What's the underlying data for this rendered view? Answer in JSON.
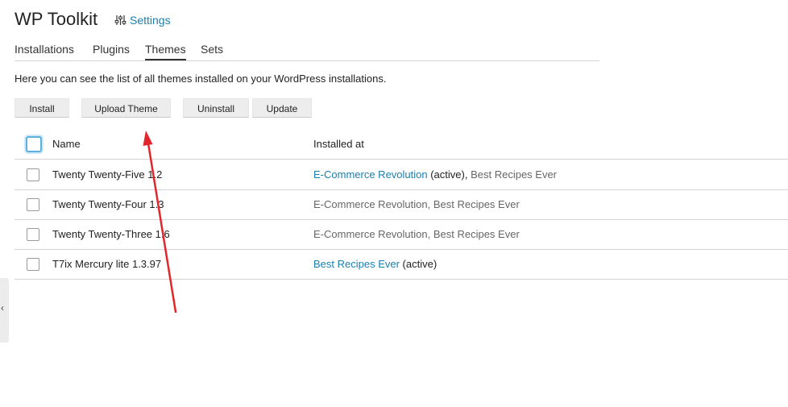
{
  "header": {
    "title": "WP Toolkit",
    "settings_label": "Settings"
  },
  "tabs": [
    {
      "label": "Installations"
    },
    {
      "label": "Plugins"
    },
    {
      "label": "Themes",
      "active": true
    },
    {
      "label": "Sets"
    }
  ],
  "intro": "Here you can see the list of all themes installed on your WordPress installations.",
  "toolbar": {
    "install": "Install",
    "upload": "Upload Theme",
    "uninstall": "Uninstall",
    "update": "Update"
  },
  "table": {
    "headers": {
      "name": "Name",
      "installed_at": "Installed at"
    },
    "rows": [
      {
        "name": "Twenty Twenty-Five 1.2",
        "site1": "E-Commerce Revolution",
        "status1": " (active)",
        "sep": ", ",
        "site2": "Best Recipes Ever"
      },
      {
        "name": "Twenty Twenty-Four 1.3",
        "site1": "E-Commerce Revolution",
        "status1": "",
        "sep": ", ",
        "site2": "Best Recipes Ever"
      },
      {
        "name": "Twenty Twenty-Three 1.6",
        "site1": "E-Commerce Revolution",
        "status1": "",
        "sep": ", ",
        "site2": "Best Recipes Ever"
      },
      {
        "name": "T7ix Mercury lite 1.3.97",
        "site1": "Best Recipes Ever",
        "status1": " (active)"
      }
    ]
  },
  "colors": {
    "link": "#1a7fae",
    "annotation_arrow": "#e3262b",
    "checkbox_focus": "#5ab0df"
  },
  "icons": {
    "settings": "sliders-icon",
    "side_handle": "chevron-left-icon"
  }
}
